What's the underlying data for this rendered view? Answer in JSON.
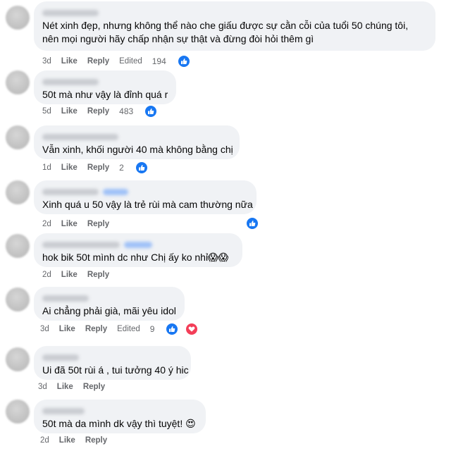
{
  "actions": {
    "like": "Like",
    "reply": "Reply",
    "edited": "Edited"
  },
  "icons": {
    "like": "thumbs-up-icon",
    "love": "heart-icon",
    "like_color": "#1877f2",
    "love_color": "#f33e58"
  },
  "comments": [
    {
      "text_lines": [
        "Nét xinh đẹp, nhưng không thể nào che giấu được sự cằn cỗi của tuổi 50 chúng tôi,",
        "nên mọi người hãy chấp nhận sự thật và đừng đòi hỏi thêm gì"
      ],
      "time": "3d",
      "edited": true,
      "reactions": "194"
    },
    {
      "text_lines": [
        "50t mà như vậy là đỉnh quá r"
      ],
      "time": "5d",
      "edited": false,
      "reactions": "483"
    },
    {
      "text_lines": [
        "Vẫn xinh, khối người 40 mà không bằng chị"
      ],
      "time": "1d",
      "edited": false,
      "reactions": "2"
    },
    {
      "text_lines": [
        "Xinh quá u 50 vậy là trẻ rùi mà cam thường nữa"
      ],
      "time": "2d",
      "edited": false,
      "reactions": ""
    },
    {
      "text_lines": [
        "hok bik 50t mình dc như Chị ấy ko nhỉ😱😱"
      ],
      "time": "2d",
      "edited": false,
      "reactions": ""
    },
    {
      "text_lines": [
        "Ai chẳng phải già, mãi yêu idol"
      ],
      "time": "3d",
      "edited": true,
      "reactions": "9"
    },
    {
      "text_lines": [
        "Ui đã 50t rùi á , tui tưởng 40 ý hic"
      ],
      "time": "3d",
      "edited": false,
      "reactions": ""
    },
    {
      "text_lines": [
        "50t mà da mình dk vậy thì tuyệt! 😍"
      ],
      "time": "2d",
      "edited": false,
      "reactions": ""
    }
  ]
}
